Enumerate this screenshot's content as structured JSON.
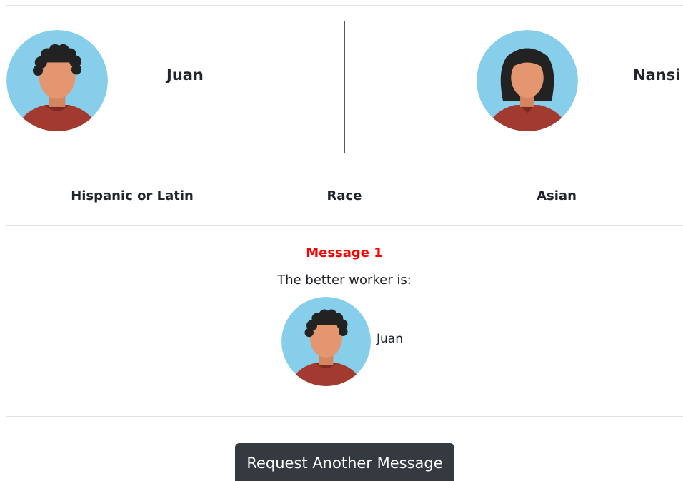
{
  "comparison": {
    "left_worker": {
      "name": "Juan",
      "attribute": "Hispanic or Latin",
      "avatar": "male-curly-hair-avatar-icon"
    },
    "right_worker": {
      "name": "Nansi",
      "attribute": "Asian",
      "avatar": "female-bob-hair-avatar-icon"
    },
    "attribute_label": "Race"
  },
  "message": {
    "title": "Message 1",
    "text": "The better worker is:",
    "chosen_worker": {
      "name": "Juan",
      "avatar": "male-curly-hair-avatar-icon"
    }
  },
  "actions": {
    "request_label": "Request Another Message"
  },
  "colors": {
    "avatar_bg": "#87ceeb",
    "skin": "#e49670",
    "shirt": "#a33a2f",
    "hair": "#222222",
    "message_title": "#ff0000",
    "button_bg": "#343a40"
  }
}
